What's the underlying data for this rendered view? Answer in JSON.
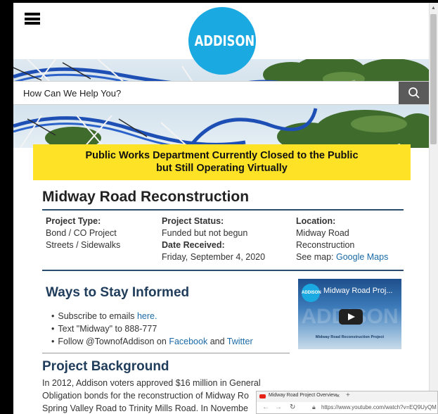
{
  "header": {
    "menu_icon": "hamburger-icon",
    "logo_text": "ADDISON"
  },
  "search": {
    "placeholder": "How Can We Help You?",
    "icon": "search-icon"
  },
  "alert": {
    "line1": "Public Works Department Currently Closed to the Public",
    "line2": "but Still Operating Virtually"
  },
  "page_title": "Midway Road Reconstruction",
  "project": {
    "type_label": "Project Type:",
    "type_values": [
      "Bond / CO Project",
      "Streets / Sidewalks"
    ],
    "status_label": "Project Status:",
    "status_value": "Funded but not begun",
    "date_label": "Date Received:",
    "date_value": "Friday, September 4, 2020",
    "location_label": "Location:",
    "location_values": [
      "Midway Road",
      "Reconstruction"
    ],
    "map_prefix": "See map: ",
    "map_link": "Google Maps"
  },
  "stay_informed": {
    "heading": "Ways to Stay Informed",
    "item1_prefix": "Subscribe to emails ",
    "item1_link": "here.",
    "item2": "Text \"Midway\" to 888-777",
    "item3_prefix": "Follow @TownofAddison on ",
    "item3_link1": "Facebook",
    "item3_mid": " and ",
    "item3_link2": "Twitter"
  },
  "video": {
    "logo_text": "ADDISON",
    "title": "Midway Road Proj...",
    "watermark": "ADDISON",
    "caption": "Midway Road Reconstruction Project"
  },
  "background": {
    "heading": "Project Background",
    "lines": [
      "In 2012, Addison voters approved $16 million in General",
      "Obligation bonds for the reconstruction of Midway Ro",
      "Spring Valley Road to Trinity Mills Road. In Novembe"
    ]
  },
  "popup": {
    "tab_title": "Midway Road Project Overview",
    "tab_close": "×",
    "tab_new": "+",
    "url": "https://www.youtube.com/watch?v=EQ9UyQM"
  },
  "colors": {
    "brand_blue": "#1ba9e1",
    "alert_yellow": "#fde226",
    "heading_navy": "#203d5c",
    "link_blue": "#1a6aa6"
  }
}
